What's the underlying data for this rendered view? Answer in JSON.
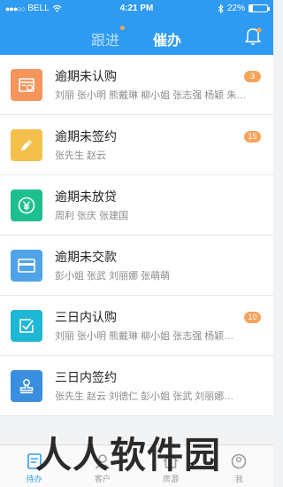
{
  "status_bar": {
    "signal": "●●●○○",
    "carrier": "BELL",
    "time": "4:21 PM",
    "battery": "22%",
    "battery_level": 0.22
  },
  "header": {
    "tabs": [
      {
        "label": "跟进",
        "active": false,
        "dot": true
      },
      {
        "label": "催办",
        "active": true,
        "dot": false
      }
    ],
    "bell_dot": true
  },
  "items": [
    {
      "title": "逾期未认购",
      "names": "刘丽  张小明  熊戴琳  柳小姐  张志强  杨颖  朱…",
      "badge": "3",
      "icon": "calendar-icon",
      "color": "#f5955b"
    },
    {
      "title": "逾期未签约",
      "names": "张先生  赵云",
      "badge": "15",
      "icon": "pencil-icon",
      "color": "#f4c04c"
    },
    {
      "title": "逾期未放贷",
      "names": "周利  张庆  张建国",
      "badge": "",
      "icon": "yen-icon",
      "color": "#1ebf8f"
    },
    {
      "title": "逾期未交款",
      "names": "彭小姐  张武  刘丽娜  张萌萌",
      "badge": "",
      "icon": "card-icon",
      "color": "#4fa3e6"
    },
    {
      "title": "三日内认购",
      "names": "刘丽  张小明  熊戴琳  柳小姐  张志强  杨颖…",
      "badge": "10",
      "icon": "checkbox-icon",
      "color": "#1eb8d6"
    },
    {
      "title": "三日内签约",
      "names": "张先生  赵云  刘德仁  彭小姐  张武  刘丽娜…",
      "badge": "",
      "icon": "stamp-icon",
      "color": "#3a8ee0"
    }
  ],
  "tabbar": [
    {
      "label": "待办",
      "active": true,
      "icon": "todo-icon"
    },
    {
      "label": "客户",
      "active": false,
      "icon": "customer-icon"
    },
    {
      "label": "房源",
      "active": false,
      "icon": "house-icon"
    },
    {
      "label": "我",
      "active": false,
      "icon": "profile-icon"
    }
  ],
  "watermark": {
    "text": "人人软件园"
  },
  "colors": {
    "primary": "#2f9bf0",
    "badge": "#f6a35b"
  }
}
